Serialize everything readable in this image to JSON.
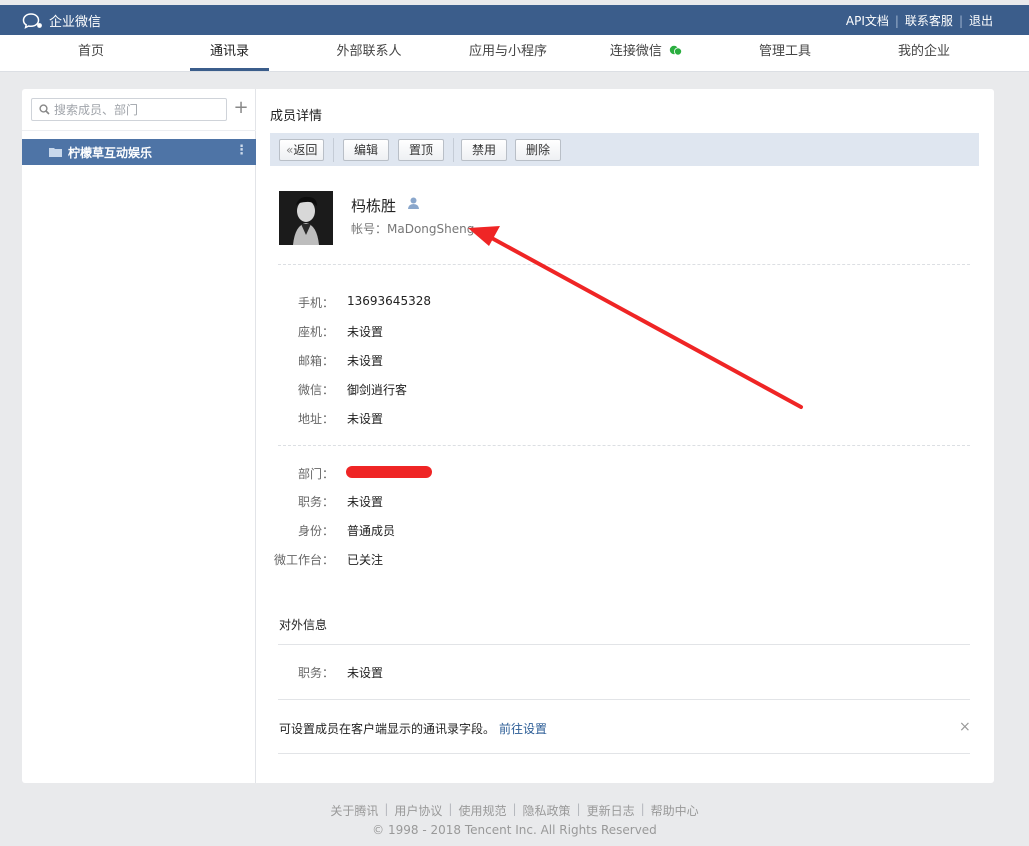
{
  "topbar": {
    "app_name": "企业微信",
    "links": [
      "API文档",
      "联系客服",
      "退出"
    ],
    "color": "#3b5d8b"
  },
  "nav": {
    "tabs": [
      "首页",
      "通讯录",
      "外部联系人",
      "应用与小程序",
      "连接微信",
      "管理工具",
      "我的企业"
    ],
    "active": "通讯录"
  },
  "sidebar": {
    "search_placeholder": "搜索成员、部门",
    "department": "柠檬草互动娱乐",
    "icons": [
      "search-icon",
      "add-icon",
      "folder-icon",
      "more-icon"
    ]
  },
  "detail": {
    "title": "成员详情",
    "toolbar": {
      "back": "返回",
      "edit": "编辑",
      "pin": "置顶",
      "disable": "禁用",
      "delete": "删除"
    },
    "name": "杩栋胜",
    "account": "帐号：MaDongSheng",
    "contact_rows": [
      {
        "label": "手机：",
        "value": "13693645328"
      },
      {
        "label": "座机：",
        "value": "未设置"
      },
      {
        "label": "邮箱：",
        "value": "未设置"
      },
      {
        "label": "微信：",
        "value": "御剑逍行客"
      },
      {
        "label": "地址：",
        "value": "未设置"
      }
    ],
    "org_rows": [
      {
        "label": "部门：",
        "value": ""
      },
      {
        "label": "职务：",
        "value": "未设置"
      },
      {
        "label": "身份：",
        "value": "普通成员"
      },
      {
        "label": "微工作台：",
        "value": "已关注"
      }
    ],
    "external": {
      "title": "对外信息",
      "rows": [
        {
          "label": "职务：",
          "value": "未设置"
        }
      ]
    },
    "tip": {
      "text": "可设置成员在客户端显示的通讯录字段。",
      "link": "前往设置",
      "close": "×"
    }
  },
  "footer": {
    "links": [
      "关于腾讯",
      "用户协议",
      "使用规范",
      "隐私政策",
      "更新日志",
      "帮助中心"
    ],
    "copyright": "© 1998 - 2018 Tencent Inc. All Rights Reserved"
  },
  "annotation": {
    "color": "#ef2525"
  }
}
